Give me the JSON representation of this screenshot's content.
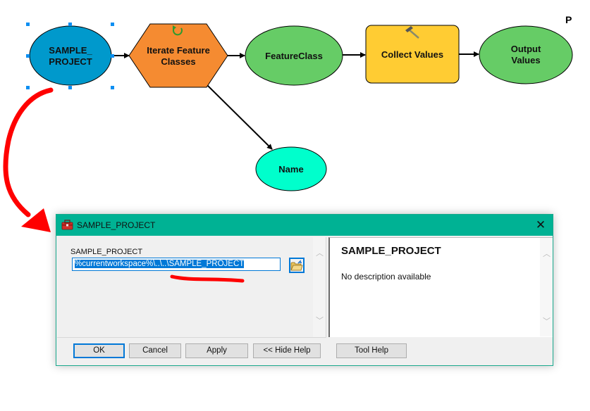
{
  "canvas": {
    "corner_text": "P",
    "nodes": [
      {
        "id": "sample-project",
        "label_lines": [
          "SAMPLE_",
          "PROJECT"
        ],
        "shape": "ellipse",
        "fill": "#0099cc",
        "selected": true
      },
      {
        "id": "iterate-feature-classes",
        "label_lines": [
          "Iterate Feature",
          "Classes"
        ],
        "shape": "hexagon",
        "fill": "#f58b31",
        "icon": "iterate-icon"
      },
      {
        "id": "featureclass",
        "label_lines": [
          "FeatureClass"
        ],
        "shape": "ellipse",
        "fill": "#66cc66"
      },
      {
        "id": "collect-values",
        "label_lines": [
          "Collect Values"
        ],
        "shape": "rounded-rect",
        "fill": "#ffcc33",
        "icon": "hammer-icon"
      },
      {
        "id": "output-values",
        "label_lines": [
          "Output",
          "Values"
        ],
        "shape": "ellipse",
        "fill": "#66cc66"
      },
      {
        "id": "name",
        "label_lines": [
          "Name"
        ],
        "shape": "ellipse",
        "fill": "#00ffcc"
      }
    ],
    "connections": [
      {
        "from": "sample-project",
        "to": "iterate-feature-classes"
      },
      {
        "from": "iterate-feature-classes",
        "to": "featureclass"
      },
      {
        "from": "featureclass",
        "to": "collect-values"
      },
      {
        "from": "collect-values",
        "to": "output-values"
      },
      {
        "from": "iterate-feature-classes",
        "to": "name"
      }
    ],
    "annotation_color": "#ff0000"
  },
  "dialog": {
    "title": "SAMPLE_PROJECT",
    "title_icon": "toolbox-icon",
    "close_icon": "close-icon",
    "accent_color": "#00b294",
    "param": {
      "label": "SAMPLE_PROJECT",
      "value": "%currentworkspace%\\..\\..\\SAMPLE_PROJECT",
      "browse_icon": "folder-browse-icon"
    },
    "help": {
      "title": "SAMPLE_PROJECT",
      "description": "No description available"
    },
    "buttons": {
      "ok": "OK",
      "cancel": "Cancel",
      "apply": "Apply",
      "hide_help": "<< Hide Help",
      "tool_help": "Tool Help"
    }
  }
}
